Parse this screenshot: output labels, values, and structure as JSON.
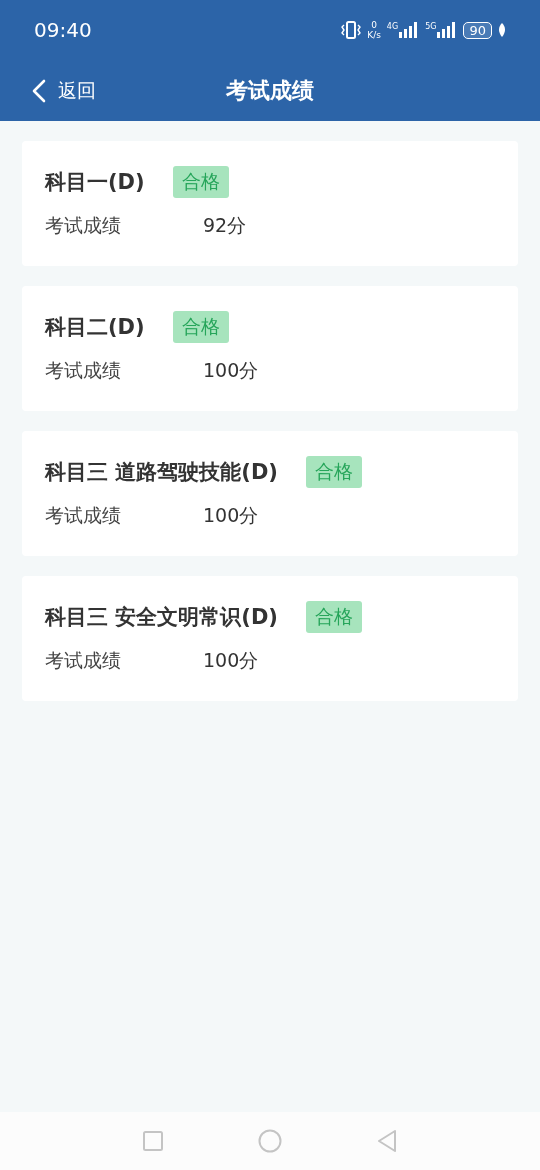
{
  "status_bar": {
    "time": "09:40",
    "speed_value": "0",
    "speed_unit": "K/s",
    "network_1": "4G",
    "network_2": "5G",
    "battery": "90"
  },
  "header": {
    "back": "返回",
    "title": "考试成绩"
  },
  "results": [
    {
      "subject": "科目一(D)",
      "badge": "合格",
      "label": "考试成绩",
      "score": "92分"
    },
    {
      "subject": "科目二(D)",
      "badge": "合格",
      "label": "考试成绩",
      "score": "100分"
    },
    {
      "subject": "科目三 道路驾驶技能(D)",
      "badge": "合格",
      "label": "考试成绩",
      "score": "100分"
    },
    {
      "subject": "科目三 安全文明常识(D)",
      "badge": "合格",
      "label": "考试成绩",
      "score": "100分"
    }
  ]
}
